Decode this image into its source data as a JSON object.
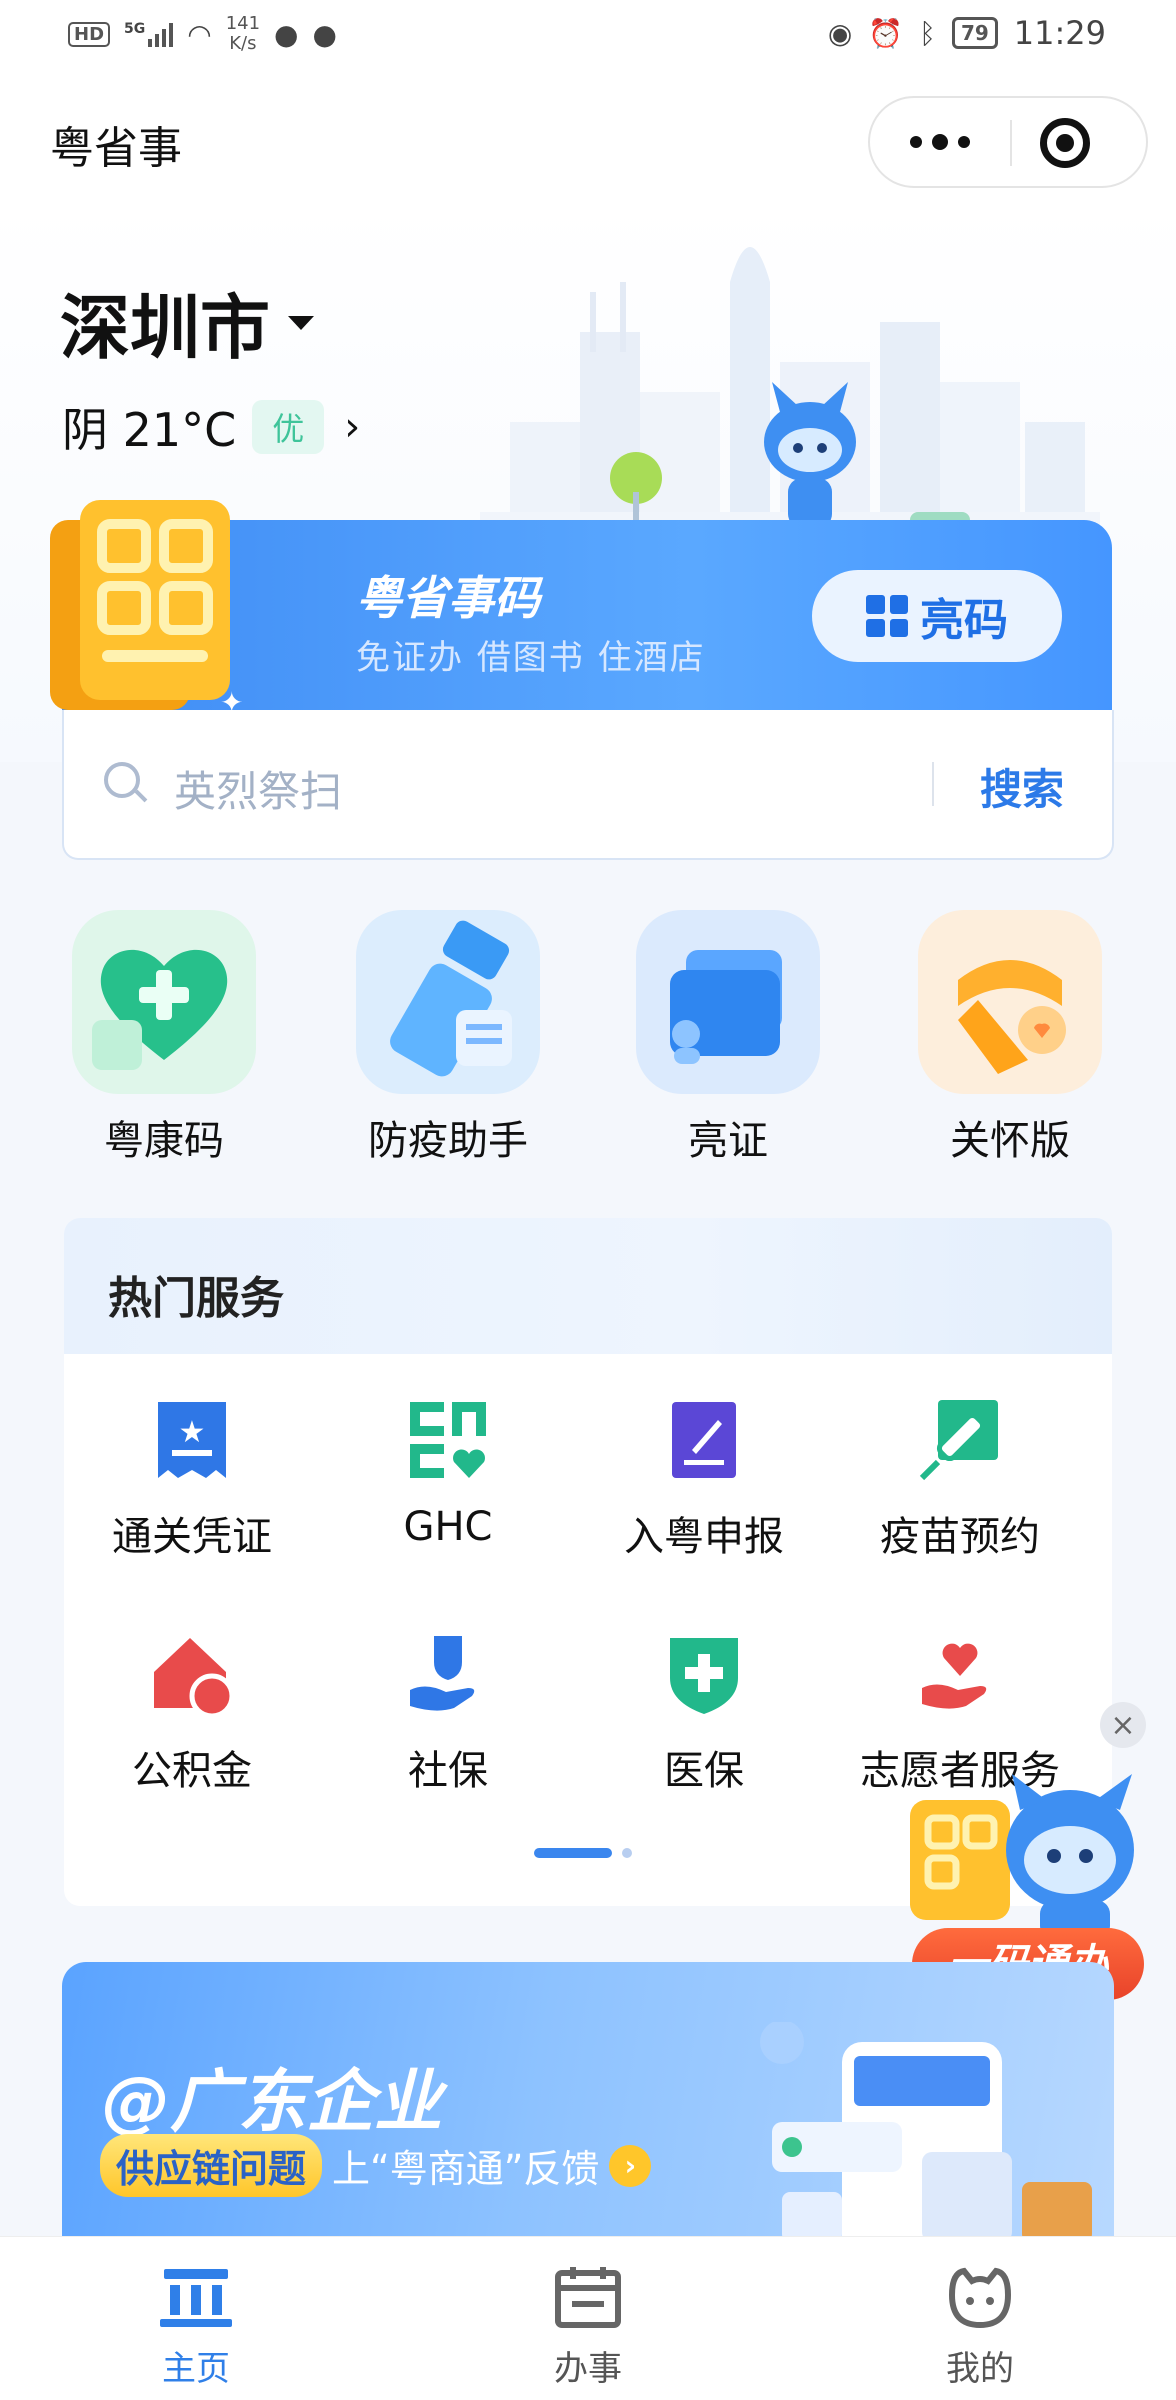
{
  "status_bar": {
    "network": "5G",
    "hd": "HD",
    "speed_value": "141",
    "speed_unit": "K/s",
    "battery": "79",
    "time": "11:29"
  },
  "header": {
    "title": "粤省事"
  },
  "hero": {
    "city": "深圳市",
    "weather": "阴 21°C",
    "aqi": "优"
  },
  "code_card": {
    "title": "粤省事码",
    "subtitle": "免证办 借图书 住酒店",
    "button": "亮码"
  },
  "search": {
    "placeholder": "英烈祭扫",
    "button": "搜索"
  },
  "quick_tiles": [
    {
      "label": "粤康码",
      "icon": "heart-plus-icon"
    },
    {
      "label": "防疫助手",
      "icon": "sprayer-icon"
    },
    {
      "label": "亮证",
      "icon": "card-wallet-icon"
    },
    {
      "label": "关怀版",
      "icon": "scarf-icon"
    }
  ],
  "hot_services": {
    "title": "热门服务",
    "items": [
      {
        "label": "通关凭证",
        "icon": "voucher-icon"
      },
      {
        "label": "GHC",
        "icon": "ghc-icon"
      },
      {
        "label": "入粤申报",
        "icon": "edit-report-icon"
      },
      {
        "label": "疫苗预约",
        "icon": "vaccine-icon"
      },
      {
        "label": "公积金",
        "icon": "house-fund-icon"
      },
      {
        "label": "社保",
        "icon": "social-insurance-icon"
      },
      {
        "label": "医保",
        "icon": "medical-insurance-icon"
      },
      {
        "label": "志愿者服务",
        "icon": "volunteer-icon"
      }
    ]
  },
  "float_widget": {
    "label": "一码通办"
  },
  "banner": {
    "title": "@广东企业",
    "pill": "供应链问题",
    "text": "上“粤商通”反馈"
  },
  "tabbar": [
    {
      "label": "主页",
      "active": true
    },
    {
      "label": "办事",
      "active": false
    },
    {
      "label": "我的",
      "active": false
    }
  ],
  "colors": {
    "primary": "#2c7ae8",
    "accent_green": "#27c08b",
    "accent_red": "#ec4b4b"
  }
}
